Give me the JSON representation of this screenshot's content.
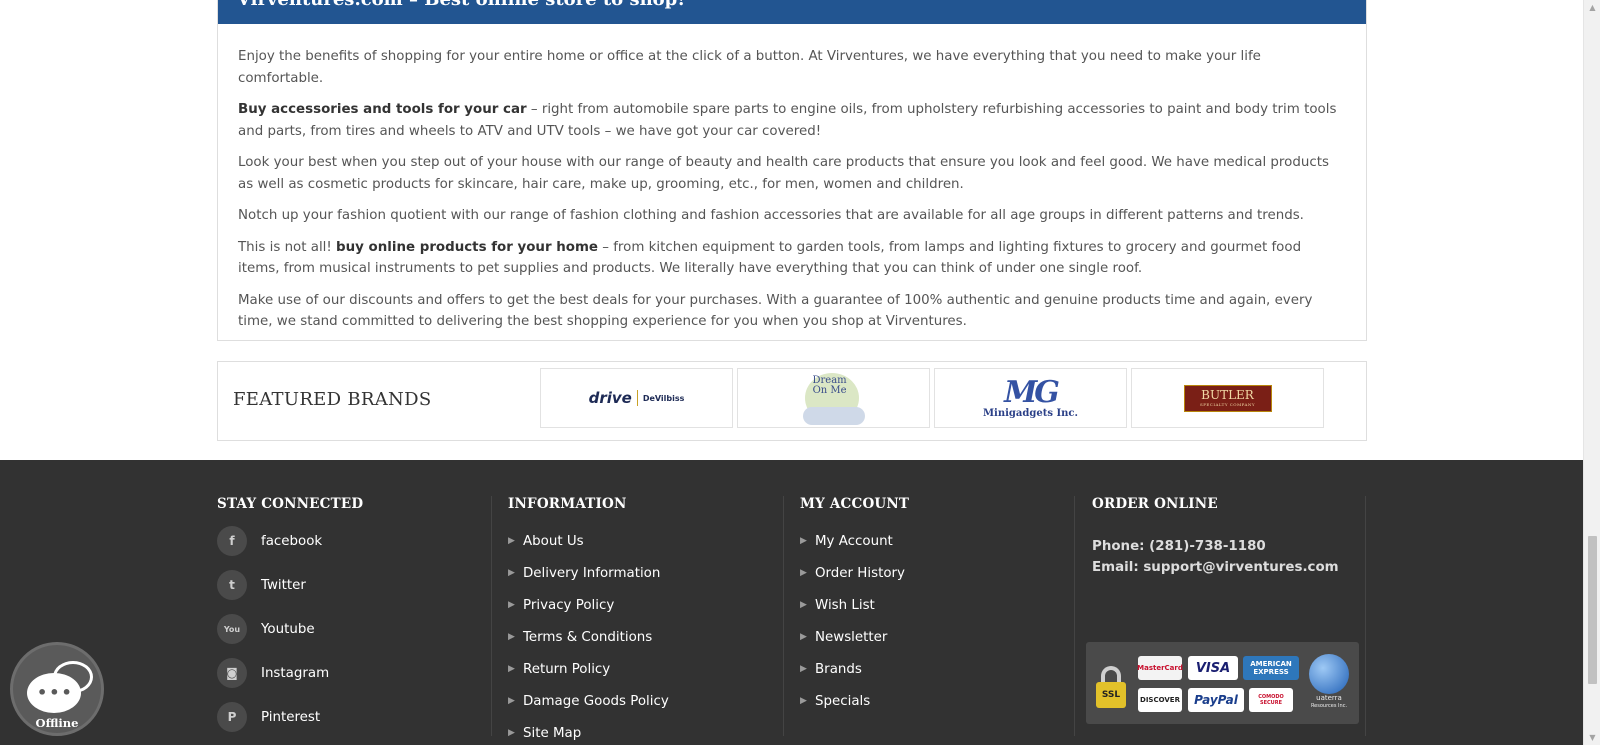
{
  "about": {
    "heading": "Virventures.com – Best online store to shop!",
    "p1": "Enjoy the benefits of shopping for your entire home or office at the click of a button. At Virventures, we have everything that you need to make your life comfortable.",
    "p2_bold": "Buy accessories and tools for your car",
    "p2_rest": " – right from automobile spare parts to engine oils, from upholstery refurbishing accessories to paint and body trim tools and parts, from tires and wheels to ATV and UTV tools – we have got your car covered!",
    "p3": "Look your best when you step out of your house with our range of beauty and health care products that ensure you look and feel good. We have medical products as well as cosmetic products for skincare, hair care, make up, grooming, etc., for men, women and children.",
    "p4": "Notch up your fashion quotient with our range of fashion clothing and fashion accessories that are available for all age groups in different patterns and trends.",
    "p5_pre": "This is not all! ",
    "p5_bold": "buy online products for your home",
    "p5_rest": " – from kitchen equipment to garden tools, from lamps and lighting fixtures to grocery and gourmet food items, from musical instruments to pet supplies and products. We literally have everything that you can think of under one single roof.",
    "p6": "Make use of our discounts and offers to get the best deals for your purchases. With a guarantee of 100% authentic and genuine products time and again, every time, we stand committed to delivering the best shopping experience for you when you shop at Virventures."
  },
  "brands": {
    "title": "FEATURED BRANDS",
    "drive": {
      "main": "drive",
      "sub": "DeVilbiss"
    },
    "dream": {
      "line1": "Dream",
      "line2": "On Me"
    },
    "minigadgets": {
      "mark": "MG",
      "name": "Minigadgets Inc."
    },
    "butler": {
      "main": "BUTLER",
      "sub": "SPECIALTY COMPANY"
    }
  },
  "footer": {
    "stay_connected": {
      "title": "STAY CONNECTED",
      "items": [
        {
          "label": "facebook",
          "icon": "f"
        },
        {
          "label": "Twitter",
          "icon": "t"
        },
        {
          "label": "Youtube",
          "icon": "You"
        },
        {
          "label": "Instagram",
          "icon": "◙"
        },
        {
          "label": "Pinterest",
          "icon": "P"
        }
      ]
    },
    "information": {
      "title": "INFORMATION",
      "items": [
        "About Us",
        "Delivery Information",
        "Privacy Policy",
        "Terms & Conditions",
        "Return Policy",
        "Damage Goods Policy",
        "Site Map"
      ]
    },
    "my_account": {
      "title": "MY ACCOUNT",
      "items": [
        "My Account",
        "Order History",
        "Wish List",
        "Newsletter",
        "Brands",
        "Specials"
      ]
    },
    "order_online": {
      "title": "ORDER ONLINE",
      "phone": "Phone: (281)-738-1180",
      "email": "Email: support@virventures.com",
      "payments": {
        "ssl": "SSL",
        "mastercard": "MasterCard",
        "visa": "VISA",
        "amex": "AMERICAN EXPRESS",
        "discover": "DISCOVER",
        "paypal": "PayPal",
        "comodo": "COMODO SECURE",
        "uaterra": "uaterra",
        "uaterra_sub": "Resources Inc."
      }
    }
  },
  "chat": {
    "status": "Offline"
  },
  "colors": {
    "header_blue": "#225591",
    "footer_bg": "#323232"
  }
}
